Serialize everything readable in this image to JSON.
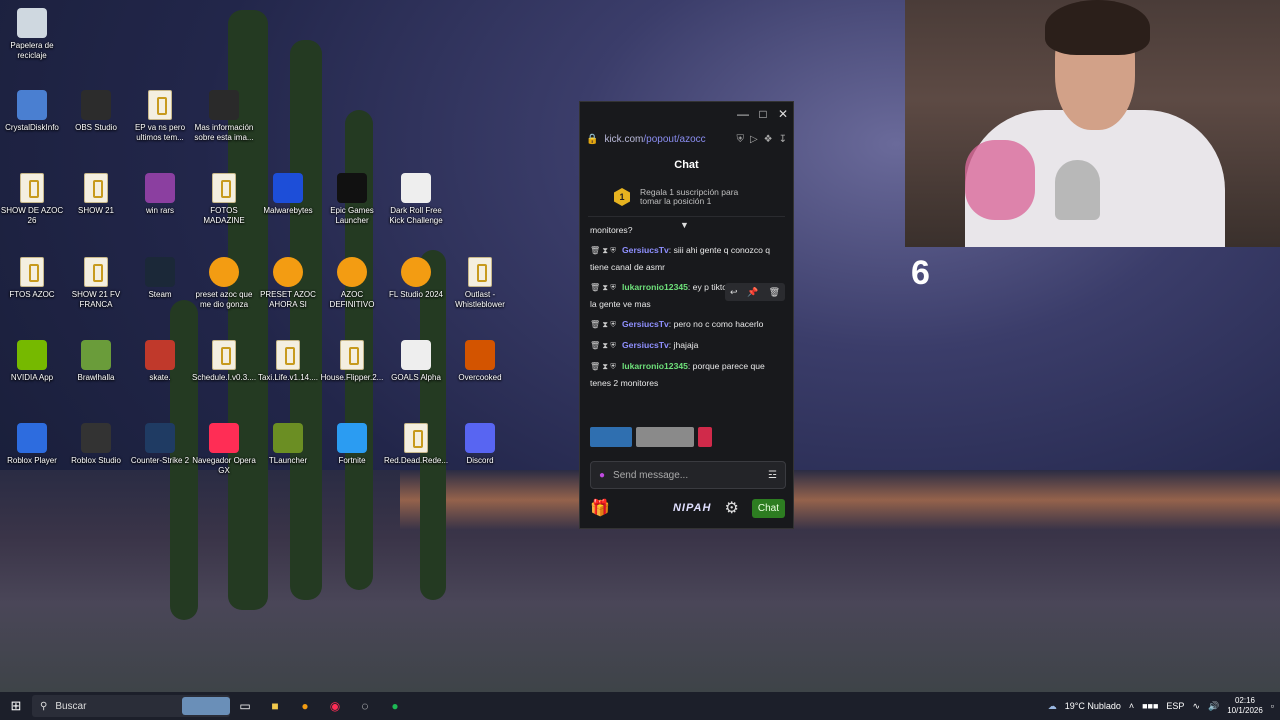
{
  "desktop": {
    "icons": [
      {
        "label": "Papelera de reciclaje",
        "icon": "recycle-bin-icon"
      },
      {
        "label": "CrystalDiskInfo",
        "icon": "crystaldiskinfo-icon"
      },
      {
        "label": "OBS Studio",
        "icon": "obs-icon"
      },
      {
        "label": "EP va ns pero ultimos tem...",
        "icon": "folder-zip-icon"
      },
      {
        "label": "Mas información sobre esta ima...",
        "icon": "info-icon"
      },
      {
        "label": "SHOW DE AZOC 26",
        "icon": "folder-zip-icon"
      },
      {
        "label": "SHOW 21",
        "icon": "folder-zip-icon"
      },
      {
        "label": "win rars",
        "icon": "winrar-icon"
      },
      {
        "label": "FOTOS MADAZINE",
        "icon": "folder-zip-icon"
      },
      {
        "label": "Malwarebytes",
        "icon": "malwarebytes-icon"
      },
      {
        "label": "Epic Games Launcher",
        "icon": "epic-games-icon"
      },
      {
        "label": "Dark Roll Free Kick Challenge",
        "icon": "soccer-ball-icon"
      },
      {
        "label": "FTOS AZOC",
        "icon": "folder-zip-icon"
      },
      {
        "label": "SHOW 21 FV FRANCA",
        "icon": "folder-zip-icon"
      },
      {
        "label": "Steam",
        "icon": "steam-icon"
      },
      {
        "label": "preset azoc que me dio gonza",
        "icon": "fl-studio-icon"
      },
      {
        "label": "PRESET AZOC AHORA SI",
        "icon": "fl-studio-icon"
      },
      {
        "label": "AZOC DEFINITIVO",
        "icon": "fl-studio-icon"
      },
      {
        "label": "FL Studio 2024",
        "icon": "fl-studio-icon"
      },
      {
        "label": "Outlast - Whistleblower",
        "icon": "file-icon"
      },
      {
        "label": "NVIDIA App",
        "icon": "nvidia-icon"
      },
      {
        "label": "Brawlhalla",
        "icon": "brawlhalla-icon"
      },
      {
        "label": "skate.",
        "icon": "skate-icon"
      },
      {
        "label": "Schedule.I.v0.3....",
        "icon": "file-icon"
      },
      {
        "label": "Taxi.Life.v1.14....",
        "icon": "file-icon"
      },
      {
        "label": "House.Flipper.2...",
        "icon": "file-icon"
      },
      {
        "label": "GOALS Alpha",
        "icon": "goals-icon"
      },
      {
        "label": "Overcooked",
        "icon": "overcooked-icon"
      },
      {
        "label": "Roblox Player",
        "icon": "roblox-icon"
      },
      {
        "label": "Roblox Studio",
        "icon": "roblox-studio-icon"
      },
      {
        "label": "Counter-Strike 2",
        "icon": "cs2-icon"
      },
      {
        "label": "Navegador Opera GX",
        "icon": "opera-gx-icon"
      },
      {
        "label": "TLauncher",
        "icon": "tlauncher-icon"
      },
      {
        "label": "Fortnite",
        "icon": "fortnite-icon"
      },
      {
        "label": "Red.Dead.Rede...",
        "icon": "file-icon"
      },
      {
        "label": "Discord",
        "icon": "discord-icon"
      }
    ]
  },
  "kick": {
    "url_host": "kick.com",
    "url_path": "/popout/azocc",
    "chat_title": "Chat",
    "sub_line1": "Regala 1 suscripción para",
    "sub_line2": "tomar la posición 1",
    "sub_rank": "1",
    "messages": [
      {
        "user": "",
        "text": "monitores?"
      },
      {
        "user": "GersiucsTv",
        "text": ": siii ahi gente q conozco q tiene canal de asmr",
        "color": "u1"
      },
      {
        "user": "lukarronio12345",
        "text": ": ey p tiktok también ahi la gente ve mas",
        "color": "u2"
      },
      {
        "user": "GersiucsTv",
        "text": ": pero no c como hacerlo",
        "color": "u1"
      },
      {
        "user": "GersiucsTv",
        "text": ": jhajaja",
        "color": "u1"
      },
      {
        "user": "lukarronio12345",
        "text": ": porque parece que tenes 2 monitores",
        "color": "u2"
      }
    ],
    "input_placeholder": "Send message...",
    "brand": "NIPAH",
    "chat_button": "Chat"
  },
  "overlay": {
    "number": "6"
  },
  "taskbar": {
    "search_label": "Buscar",
    "weather": "19°C Nublado",
    "language": "ESP",
    "time": "02:16",
    "date": "10/1/2026"
  }
}
